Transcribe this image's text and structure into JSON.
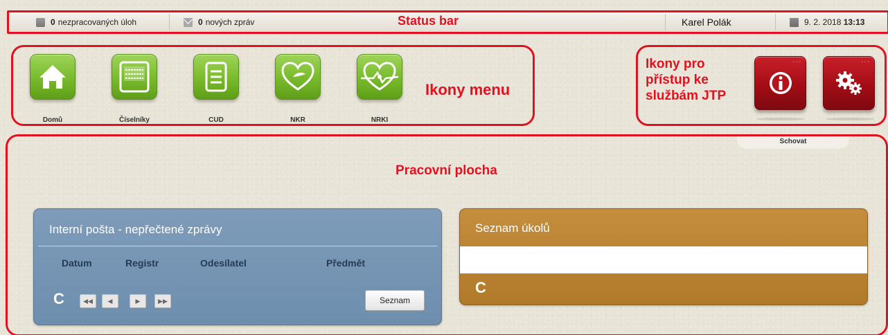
{
  "status_bar": {
    "tasks_count": "0",
    "tasks_label": "nezpracovaných úloh",
    "messages_count": "0",
    "messages_label": "nových zpráv",
    "user": "Karel Polák",
    "date": "9. 2. 2018",
    "time": "13:13"
  },
  "menu": {
    "items": [
      {
        "label": "Domů",
        "icon": "home-icon"
      },
      {
        "label": "Číselníky",
        "icon": "codelist-icon"
      },
      {
        "label": "CUD",
        "icon": "cud-icon"
      },
      {
        "label": "NKR",
        "icon": "heart-icon"
      },
      {
        "label": "NRKI",
        "icon": "heart-check-icon"
      }
    ],
    "service_icons": [
      {
        "icon": "info-icon"
      },
      {
        "icon": "gears-icon"
      }
    ]
  },
  "annotations": {
    "status_bar": "Status bar",
    "menu_icons": "Ikony menu",
    "jtp_line1": "Ikony pro",
    "jtp_line2": "přístup ke",
    "jtp_line3": "službám JTP",
    "workspace": "Pracovní plocha"
  },
  "workspace": {
    "hide_label": "Schovat",
    "mail_panel": {
      "title": "Interní pošta - nepřečtené zprávy",
      "columns": [
        "Datum",
        "Registr",
        "Odesílatel",
        "Předmět"
      ],
      "list_button": "Seznam"
    },
    "tasks_panel": {
      "title": "Seznam úkolů"
    }
  },
  "colors": {
    "annotation": "#e3101f",
    "menu_tile": "#7bbd2e",
    "service_tile": "#a30c15",
    "mail_panel": "#7292b3",
    "tasks_panel": "#b88330"
  }
}
